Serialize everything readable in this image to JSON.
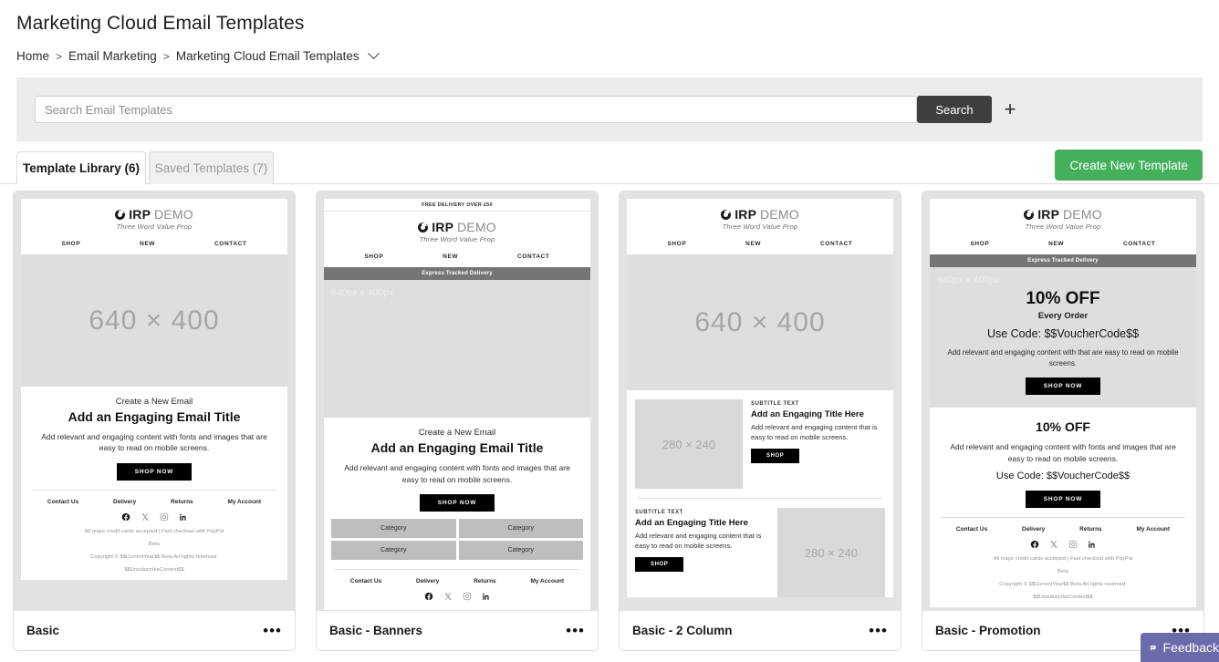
{
  "header": {
    "title": "Marketing Cloud Email Templates",
    "breadcrumb": [
      "Home",
      "Email Marketing",
      "Marketing Cloud Email Templates"
    ],
    "separator": ">"
  },
  "search": {
    "placeholder": "Search Email Templates",
    "value": "",
    "button_label": "Search",
    "add_label": "+"
  },
  "tabs": [
    {
      "label": "Template Library (6)",
      "active": true
    },
    {
      "label": "Saved Templates (7)",
      "active": false
    }
  ],
  "actions": {
    "create_label": "Create New Template",
    "create_color": "#44b05b"
  },
  "brand": {
    "name": "IRP",
    "demo": "DEMO",
    "tagline": "Three Word Value Prop",
    "nav": [
      "SHOP",
      "NEW",
      "CONTACT"
    ]
  },
  "common": {
    "delivery_promo": "FREE DELIVERY OVER £50",
    "express_bar": "Express Tracked Delivery",
    "hero_label": "640 × 400",
    "hero_corner": "640px x 400px",
    "thumb_label": "280 × 240",
    "eyebrow": "Create a New Email",
    "big_title": "Add an Engaging Email Title",
    "body_copy": "Add relevant and engaging content with fonts and images that are easy to read on mobile screens.",
    "shop_now": "SHOP NOW",
    "shop": "SHOP",
    "footer_links": [
      "Contact Us",
      "Delivery",
      "Returns",
      "My Account"
    ],
    "social_icons": [
      "facebook-icon",
      "x-icon",
      "instagram-icon",
      "linkedin-icon"
    ],
    "fine_payments": "All major credit cards accepted | Fast checkout with PayPal",
    "fine_company": "Beta",
    "fine_copyright": "Copyright © $$CurrentYear$$ Beta All rights reserved.",
    "fine_unsubscribe": "$$UnsubscribeContent$$",
    "category_label": "Category",
    "subtitle_text": "SUBTITLE TEXT",
    "col_title": "Add an Engaging Title Here",
    "col_copy": "Add relevant and engaging content that is easy to read on mobile screens.",
    "promo_pct": "10% OFF",
    "promo_sub": "Every Order",
    "promo_code": "Use Code: $$VoucherCode$$",
    "promo_copy": "Add relevant and engaging content with that are easy to read on mobile screens.",
    "menu_dots": "•••"
  },
  "cards": [
    {
      "name": "Basic"
    },
    {
      "name": "Basic - Banners"
    },
    {
      "name": "Basic - 2 Column"
    },
    {
      "name": "Basic - Promotion"
    }
  ],
  "feedback": {
    "label": "Feedback",
    "color": "#6b6bac"
  }
}
